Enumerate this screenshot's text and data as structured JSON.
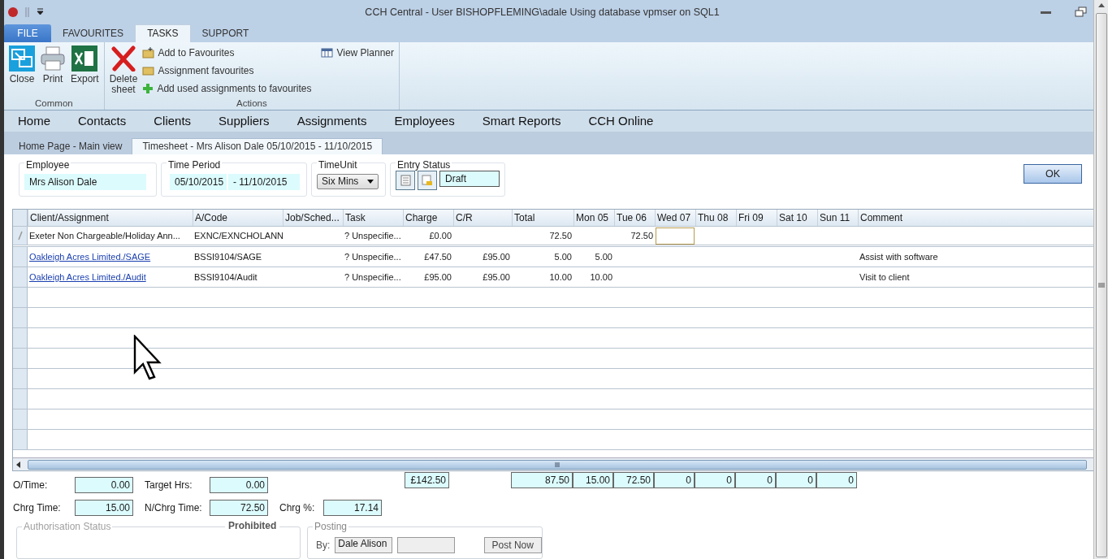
{
  "window": {
    "title": "CCH Central - User BISHOPFLEMING\\adale Using database vpmser on SQL1"
  },
  "ribbon_tabs": [
    {
      "label": "FILE",
      "kind": "file",
      "selected": false
    },
    {
      "label": "FAVOURITES",
      "kind": "tab",
      "selected": false
    },
    {
      "label": "TASKS",
      "kind": "tab",
      "selected": true
    },
    {
      "label": "SUPPORT",
      "kind": "tab",
      "selected": false
    }
  ],
  "ribbon_groups": [
    {
      "label": "Common",
      "kind": "large",
      "items": [
        {
          "label": "Close"
        },
        {
          "label": "Print"
        },
        {
          "label": "Export"
        }
      ]
    },
    {
      "label": "Actions",
      "kind": "actions",
      "large": {
        "label": "Delete\nsheet"
      },
      "items": [
        {
          "label": "Add to Favourites"
        },
        {
          "label": "Assignment favourites"
        },
        {
          "label": "Add used assignments to favourites"
        }
      ],
      "side": {
        "label": "View Planner"
      }
    }
  ],
  "nav": [
    "Home",
    "Contacts",
    "Clients",
    "Suppliers",
    "Assignments",
    "Employees",
    "Smart Reports",
    "CCH Online"
  ],
  "doc_tabs": [
    {
      "label": "Home Page - Main view",
      "selected": false
    },
    {
      "label": "Timesheet - Mrs Alison Dale 05/10/2015 - 11/10/2015",
      "selected": true
    }
  ],
  "form": {
    "employee": {
      "label": "Employee",
      "value": "Mrs Alison Dale"
    },
    "time_period": {
      "label": "Time Period",
      "from": "05/10/2015",
      "to": "- 11/10/2015"
    },
    "time_unit": {
      "label": "TimeUnit",
      "value": "Six Mins"
    },
    "entry_status": {
      "label": "Entry Status",
      "value": "Draft"
    },
    "ok_button": "OK"
  },
  "grid": {
    "columns": [
      "Client/Assignment",
      "A/Code",
      "Job/Sched...",
      "Task",
      "Charge",
      "C/R",
      "Total",
      "Mon 05",
      "Tue 06",
      "Wed 07",
      "Thu 08",
      "Fri 09",
      "Sat 10",
      "Sun 11",
      "Comment"
    ],
    "rows": [
      {
        "client": "Exeter Non Chargeable/Holiday Ann...",
        "link": false,
        "editing": true,
        "a_code": "EXNC/EXNCHOLANN",
        "task": "? Unspecifie...",
        "charge": "£0.00",
        "total": "72.50",
        "days": {
          "tue": {
            "value": "72.50",
            "focused": false
          },
          "wed": {
            "focused": true
          }
        }
      },
      {
        "client": "Oakleigh Acres Limited./SAGE",
        "link": true,
        "editing": false,
        "a_code": "BSSI9104/SAGE",
        "task": "? Unspecifie...",
        "charge": "£47.50",
        "cr": "£95.00",
        "total": "5.00",
        "days": {
          "mon": {
            "value": "5.00",
            "focused": false
          }
        },
        "comment": "Assist with software"
      },
      {
        "client": "Oakleigh Acres Limited./Audit",
        "link": true,
        "editing": false,
        "a_code": "BSSI9104/Audit",
        "task": "? Unspecifie...",
        "charge": "£95.00",
        "cr": "£95.00",
        "total": "10.00",
        "days": {
          "mon": {
            "value": "10.00",
            "focused": false
          }
        },
        "comment": "Visit to client"
      }
    ],
    "totals": {
      "charge": "£142.50",
      "total": "87.50",
      "days": [
        "15.00",
        "72.50",
        "0",
        "0",
        "0",
        "0",
        "0"
      ]
    }
  },
  "summary": [
    [
      {
        "label": "O/Time:",
        "value": "0.00"
      },
      {
        "label": "Target Hrs:",
        "value": "0.00"
      }
    ],
    [
      {
        "label": "Chrg Time:",
        "value": "15.00"
      },
      {
        "label": "N/Chrg Time:",
        "value": "72.50"
      },
      {
        "label": "Chrg %:",
        "value": "17.14"
      }
    ]
  ],
  "authorisation": {
    "label": "Authorisation Status",
    "status": "Prohibited",
    "disabled": true
  },
  "posting": {
    "label": "Posting",
    "by_label": "By:",
    "by_value": "Dale Alison",
    "button": "Post Now"
  }
}
